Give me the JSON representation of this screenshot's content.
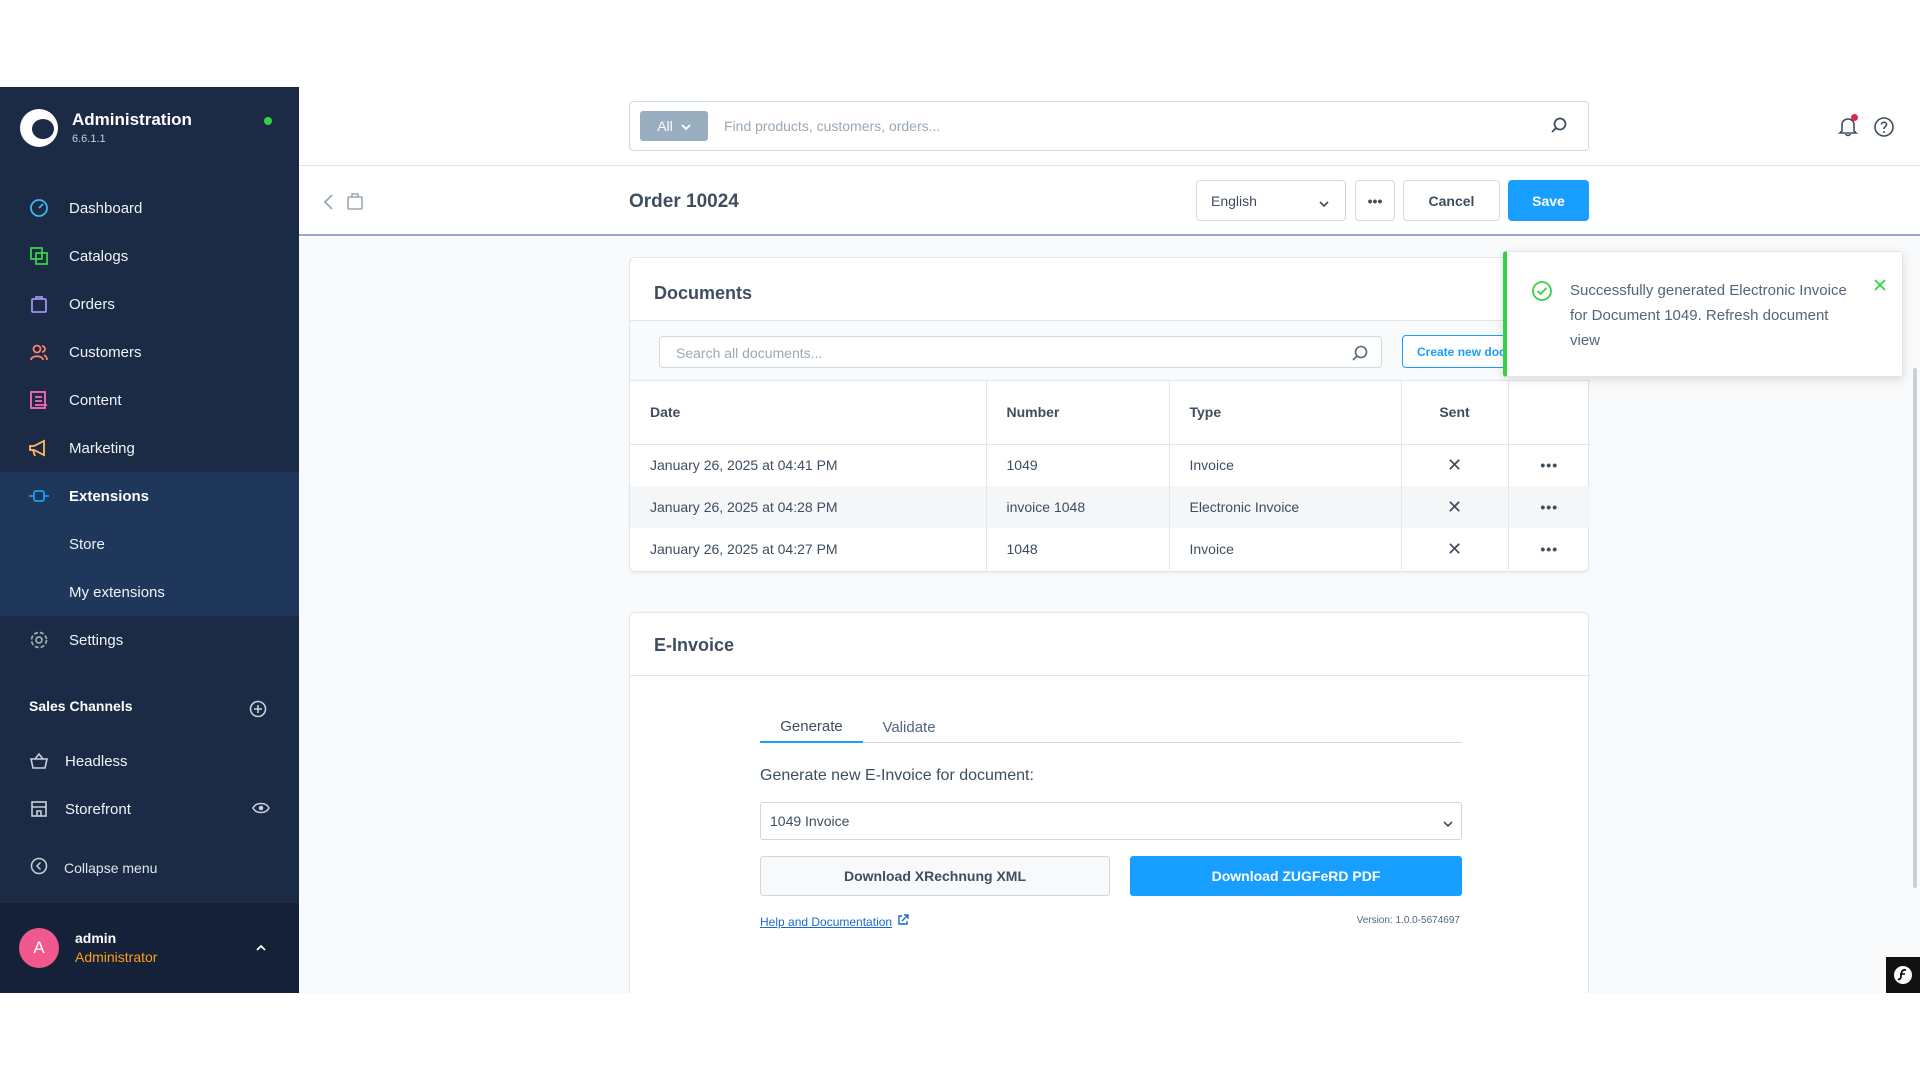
{
  "brand": {
    "title": "Administration",
    "version": "6.6.1.1"
  },
  "nav": {
    "dashboard": "Dashboard",
    "catalogs": "Catalogs",
    "orders": "Orders",
    "customers": "Customers",
    "content": "Content",
    "marketing": "Marketing",
    "extensions": "Extensions",
    "store": "Store",
    "my_extensions": "My extensions",
    "settings": "Settings"
  },
  "sales_channels": {
    "header": "Sales Channels",
    "items": [
      "Headless",
      "Storefront"
    ]
  },
  "collapse_label": "Collapse menu",
  "user": {
    "initial": "A",
    "name": "admin",
    "role": "Administrator"
  },
  "search": {
    "scope": "All",
    "placeholder": "Find products, customers, orders..."
  },
  "page": {
    "title": "Order 10024",
    "language": "English",
    "more": "•••",
    "cancel": "Cancel",
    "save": "Save"
  },
  "documents": {
    "title": "Documents",
    "search_placeholder": "Search all documents...",
    "create_label": "Create new document",
    "columns": [
      "Date",
      "Number",
      "Type",
      "Sent"
    ],
    "rows": [
      {
        "date": "January 26, 2025 at 04:41 PM",
        "number": "1049",
        "type": "Invoice",
        "sent": "✕",
        "actions": "•••"
      },
      {
        "date": "January 26, 2025 at 04:28 PM",
        "number": "invoice 1048",
        "type": "Electronic Invoice",
        "sent": "✕",
        "actions": "•••"
      },
      {
        "date": "January 26, 2025 at 04:27 PM",
        "number": "1048",
        "type": "Invoice",
        "sent": "✕",
        "actions": "•••"
      }
    ]
  },
  "einvoice": {
    "title": "E-Invoice",
    "tabs": [
      "Generate",
      "Validate"
    ],
    "generate_label": "Generate new E-Invoice for document:",
    "selected_document": "1049 Invoice",
    "download_xml": "Download XRechnung XML",
    "download_pdf": "Download ZUGFeRD PDF",
    "help_link": "Help and Documentation",
    "version": "Version: 1.0.0-5674697"
  },
  "notification": {
    "message": "Successfully generated Electronic Invoice for Document 1049. Refresh document view"
  },
  "colors": {
    "sidebar": "#1b2b45",
    "accent": "#189eff",
    "success": "#37d046",
    "danger": "#de294c"
  }
}
